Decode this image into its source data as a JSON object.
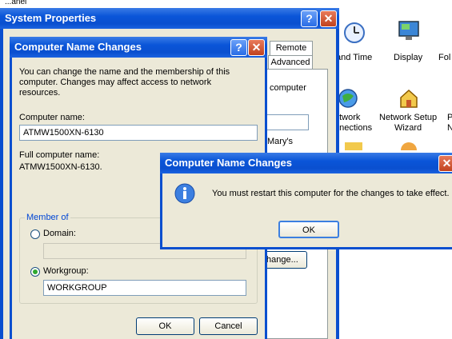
{
  "background": {
    "top_text": "...anel",
    "items": [
      {
        "label1": "and Time",
        "label2": "",
        "icon": "date-time-icon"
      },
      {
        "label1": "Display",
        "label2": "",
        "icon": "display-icon"
      },
      {
        "label1": "Fol",
        "label2": "",
        "icon": "folder-options-icon"
      },
      {
        "label1": "etwork",
        "label2": "nnections",
        "icon": "network-connections-icon"
      },
      {
        "label1": "Network Setup",
        "label2": "Wizard",
        "icon": "network-setup-wizard-icon"
      },
      {
        "label1": "P",
        "label2": "N",
        "icon": "partial-icon"
      }
    ]
  },
  "system_properties": {
    "title": "System Properties",
    "tabs": [
      "Remote",
      "Advanced"
    ],
    "fragments": {
      "computer": "computer",
      "marys": "Mary's",
      "change_button": "hange..."
    }
  },
  "computer_name_changes": {
    "title": "Computer Name Changes",
    "description": "You can change the name and the membership of this computer. Changes may affect access to network resources.",
    "computer_name_label": "Computer name:",
    "computer_name_value": "ATMW1500XN-6130",
    "full_name_label": "Full computer name:",
    "full_name_value": "ATMW1500XN-6130.",
    "member_of_label": "Member of",
    "domain_label": "Domain:",
    "domain_value": "",
    "workgroup_label": "Workgroup:",
    "workgroup_value": "WORKGROUP",
    "ok_label": "OK",
    "cancel_label": "Cancel",
    "selected": "workgroup"
  },
  "message_dialog": {
    "title": "Computer Name Changes",
    "message": "You must restart this computer for the changes to take effect.",
    "ok_label": "OK"
  },
  "colors": {
    "titlebar": "#0a55d8",
    "window_face": "#ece9d8",
    "close_button": "#c1431e",
    "input_border": "#7f9db9"
  }
}
